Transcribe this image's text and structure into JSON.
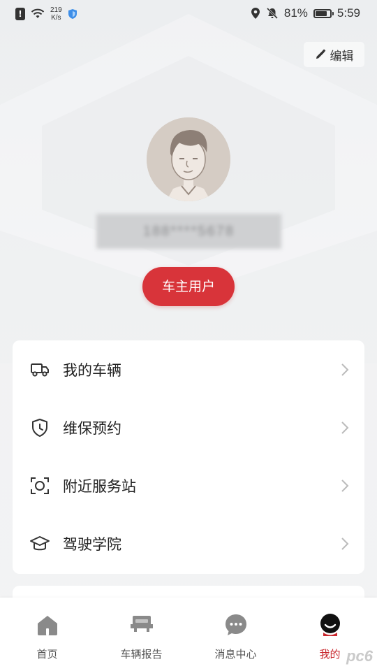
{
  "status_bar": {
    "net_speed_value": "219",
    "net_speed_unit": "K/s",
    "battery": "81%",
    "battery_level": 0.81,
    "time": "5:59"
  },
  "header": {
    "edit_label": "编辑"
  },
  "profile": {
    "username_masked": "188****5678",
    "badge": "车主用户"
  },
  "menu": [
    {
      "label": "我的车辆",
      "icon": "truck-icon"
    },
    {
      "label": "维保预约",
      "icon": "shield-clock-icon"
    },
    {
      "label": "附近服务站",
      "icon": "scan-icon"
    },
    {
      "label": "驾驶学院",
      "icon": "graduation-cap-icon"
    }
  ],
  "tabs": [
    {
      "label": "首页",
      "icon": "home-icon",
      "active": false
    },
    {
      "label": "车辆报告",
      "icon": "car-icon",
      "active": false
    },
    {
      "label": "消息中心",
      "icon": "chat-icon",
      "active": false
    },
    {
      "label": "我的",
      "icon": "profile-icon",
      "active": true
    }
  ],
  "colors": {
    "accent": "#d8343a",
    "active_tab": "#c8262c"
  },
  "watermark": "pc6"
}
